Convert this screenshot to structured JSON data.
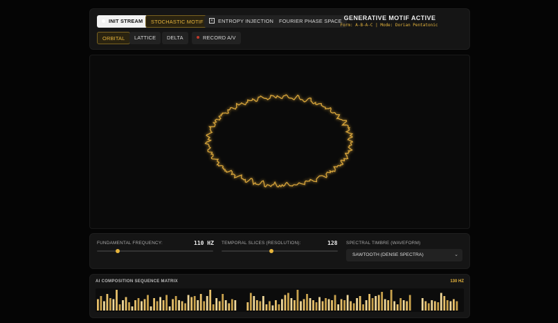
{
  "toolbar": {
    "buttons_row1": [
      {
        "label": "INIT STREAM",
        "style": "active-white",
        "icon": "dot-icon"
      },
      {
        "label": "STOCHASTIC MOTIF",
        "style": "active-gold",
        "icon": ""
      },
      {
        "label": "ENTROPY INJECTION",
        "style": "normal",
        "icon": "checkbox-x-icon"
      },
      {
        "label": "FOURIER PHASE SPACE",
        "style": "normal",
        "icon": ""
      }
    ],
    "buttons_row2": [
      {
        "label": "ORBITAL",
        "style": "active-gold",
        "icon": ""
      },
      {
        "label": "LATTICE",
        "style": "normal",
        "icon": ""
      },
      {
        "label": "DELTA",
        "style": "normal",
        "icon": ""
      },
      {
        "label": "RECORD A/V",
        "style": "normal",
        "icon": "record-dot-icon"
      }
    ],
    "status_title": "GENERATIVE MOTIF ACTIVE",
    "status_sub": "Form: A-B-A-C | Mode: Dorian Pentatonic"
  },
  "controls": {
    "freq_label": "FUNDAMENTAL FREQUENCY:",
    "freq_value": "110 HZ",
    "freq_level": 0.18,
    "slices_label": "TEMPORAL SLICES (RESOLUTION):",
    "slices_value": "128",
    "slices_level": 0.43,
    "timbre_label": "SPECTRAL TIMBRE (WAVEFORM)",
    "timbre_value": "SAWTOOTH (DENSE SPECTRA)"
  },
  "matrix": {
    "title": "AI COMPOSITION SEQUENCE MATRIX",
    "hz": "130 HZ",
    "bars": [
      0.55,
      0.7,
      0.45,
      0.8,
      0.6,
      0.55,
      1.0,
      0.3,
      0.5,
      0.65,
      0.4,
      0.2,
      0.5,
      0.6,
      0.45,
      0.55,
      0.75,
      0.2,
      0.6,
      0.45,
      0.65,
      0.5,
      0.75,
      0.2,
      0.55,
      0.7,
      0.5,
      0.45,
      0.35,
      0.75,
      0.65,
      0.7,
      0.5,
      0.8,
      0.45,
      0.7,
      1.0,
      0.3,
      0.6,
      0.45,
      0.8,
      0.5,
      0.35,
      0.55,
      0.5,
      0.4,
      0.85,
      0.7,
      0.5,
      0.45,
      0.7,
      0.3,
      0.45,
      0.25,
      0.5,
      0.3,
      0.55,
      0.75,
      0.85,
      0.6,
      0.5,
      1.0,
      0.45,
      0.55,
      0.8,
      0.6,
      0.5,
      0.4,
      0.65,
      0.45,
      0.6,
      0.55,
      0.5,
      0.75,
      0.3,
      0.55,
      0.5,
      0.75,
      0.45,
      0.35,
      0.6,
      0.7,
      0.3,
      0.5,
      0.8,
      0.6,
      0.7,
      0.75,
      0.9,
      0.55,
      0.5,
      1.0,
      0.45,
      0.3,
      0.6,
      0.5,
      0.45,
      0.75,
      0.6,
      0.45,
      0.35,
      0.5,
      0.45,
      0.4,
      0.85,
      0.7,
      0.5,
      0.45,
      0.55,
      0.45
    ],
    "bar_colors": [
      "#e7c06a",
      "#c9a24d",
      "#f0d89a"
    ]
  },
  "colors": {
    "accent": "#e7b53c",
    "orbit": "#d8a53a"
  }
}
